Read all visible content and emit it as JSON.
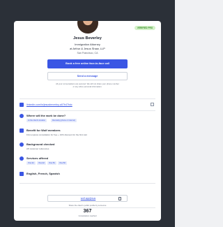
{
  "profile": {
    "badge": "VERIFIED PRO",
    "name": "Jesus Beverley",
    "title": "Immigration Attorney",
    "company": "at Arthur & Jesus Shaw, LLP",
    "location": "San Francisco, CA"
  },
  "actions": {
    "primary_label": "Book a free online face-to-face call",
    "secondary_label": "Send a message",
    "secure_note": "All your conversations are secured. We will not share your phone number or any other personal information."
  },
  "details": {
    "linkedin": "linkedin.com/in/jesusbeverley-a07b47bdc",
    "work_location": {
      "label": "Where will the work be done?",
      "chips": [
        "At the client's location",
        "Remotely (phone or internet)"
      ]
    },
    "benefit": {
      "label": "Benefit for Wolf members",
      "sub": "First express consultation for free + 10% discount for the first visit"
    },
    "background": {
      "label": "Background checked",
      "sub": "2/2 customer references"
    },
    "services": {
      "label": "Services offered",
      "chips": [
        "Visa E1",
        "Visa E2",
        "Visa B1",
        "Visa B2"
      ]
    },
    "languages": "English, French, Spanish"
  },
  "share": {
    "url": "wolf.app/jesus",
    "note": "Share the client's public profile by someone",
    "count": "367",
    "count_label": "Consultations reached"
  }
}
